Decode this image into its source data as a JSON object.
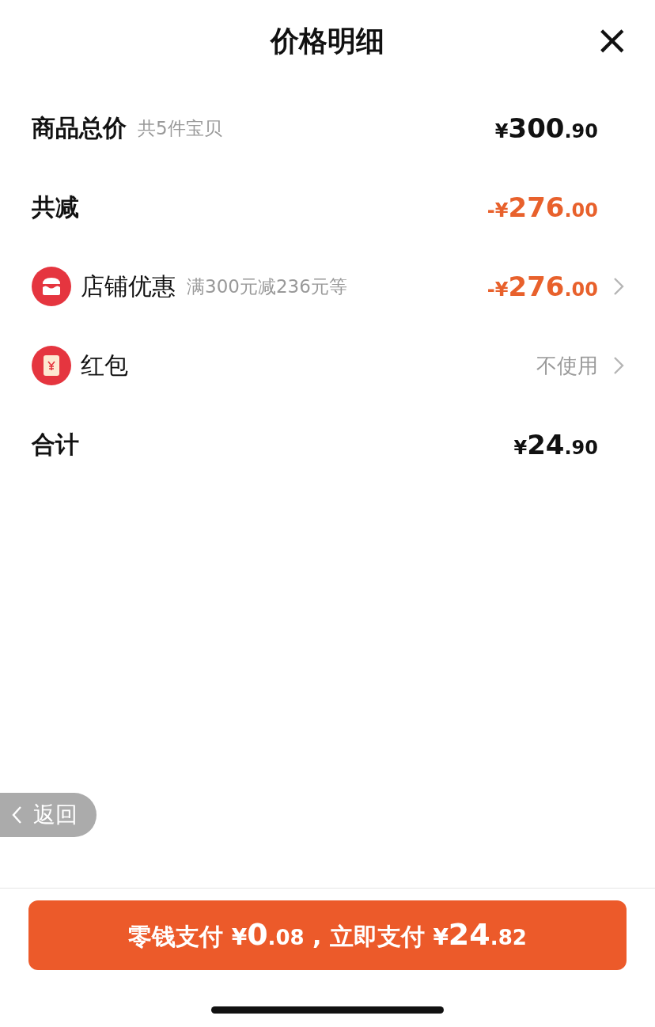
{
  "header": {
    "title": "价格明细",
    "close": "×"
  },
  "rows": [
    {
      "kind": "total",
      "label": "商品总价",
      "note": "共5件宝贝",
      "value": [
        {
          "kind": "unit",
          "text": "¥"
        },
        {
          "kind": "integer",
          "text": "300"
        },
        {
          "kind": "decimal",
          "text": ".90"
        }
      ]
    },
    {
      "kind": "reduction",
      "label": "共减",
      "value": [
        {
          "kind": "unit",
          "text": "-¥"
        },
        {
          "kind": "integer",
          "text": "276"
        },
        {
          "kind": "decimal",
          "text": ".00"
        }
      ]
    },
    {
      "kind": "shop",
      "label": "店铺优惠",
      "note": "满300元减236元等",
      "value": [
        {
          "kind": "unit",
          "text": "-¥"
        },
        {
          "kind": "integer",
          "text": "276"
        },
        {
          "kind": "decimal",
          "text": ".00"
        }
      ]
    },
    {
      "kind": "packet",
      "label": "红包",
      "value": [
        {
          "kind": "plain",
          "text": "不使用"
        }
      ]
    },
    {
      "kind": "total",
      "label": "合计",
      "value": [
        {
          "kind": "unit",
          "text": "¥"
        },
        {
          "kind": "integer",
          "text": "24"
        },
        {
          "kind": "decimal",
          "text": ".90"
        }
      ]
    }
  ],
  "back_button": {
    "label": "返回"
  },
  "pay_button": {
    "parts": [
      {
        "kind": "plain",
        "text": "零钱支付 "
      },
      {
        "kind": "unit",
        "text": "¥"
      },
      {
        "kind": "integer",
        "text": "0"
      },
      {
        "kind": "decimal",
        "text": ".08"
      },
      {
        "kind": "plain",
        "text": " , 立即支付 "
      },
      {
        "kind": "unit",
        "text": "¥"
      },
      {
        "kind": "integer",
        "text": "24"
      },
      {
        "kind": "decimal",
        "text": ".82"
      }
    ]
  }
}
